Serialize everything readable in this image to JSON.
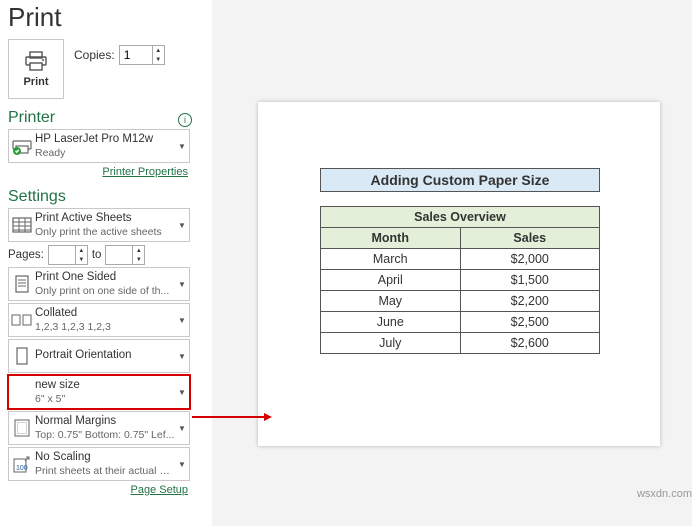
{
  "page_title": "Print",
  "copies": {
    "label": "Copies:",
    "value": "1"
  },
  "big_print": {
    "label": "Print"
  },
  "printer_heading": "Printer",
  "printer": {
    "name": "HP LaserJet Pro M12w",
    "status": "Ready"
  },
  "printer_properties": "Printer Properties",
  "settings_heading": "Settings",
  "settings": {
    "print_what": {
      "title": "Print Active Sheets",
      "sub": "Only print the active sheets"
    },
    "pages": {
      "label": "Pages:",
      "to": "to"
    },
    "sided": {
      "title": "Print One Sided",
      "sub": "Only print on one side of th..."
    },
    "collated": {
      "title": "Collated",
      "sub": "1,2,3    1,2,3    1,2,3"
    },
    "orientation": {
      "title": "Portrait Orientation",
      "sub": ""
    },
    "paper_size": {
      "title": "new size",
      "sub": "6\" x 5\""
    },
    "margins": {
      "title": "Normal Margins",
      "sub": "Top: 0.75\" Bottom: 0.75\" Lef..."
    },
    "scaling": {
      "title": "No Scaling",
      "sub": "Print sheets at their actual size"
    }
  },
  "page_setup": "Page Setup",
  "chart_data": {
    "type": "table",
    "title": "Adding Custom Paper Size",
    "subtitle": "Sales Overview",
    "columns": [
      "Month",
      "Sales"
    ],
    "rows": [
      {
        "month": "March",
        "sales": "$2,000"
      },
      {
        "month": "April",
        "sales": "$1,500"
      },
      {
        "month": "May",
        "sales": "$2,200"
      },
      {
        "month": "June",
        "sales": "$2,500"
      },
      {
        "month": "July",
        "sales": "$2,600"
      }
    ]
  },
  "watermark": "wsxdn.com"
}
